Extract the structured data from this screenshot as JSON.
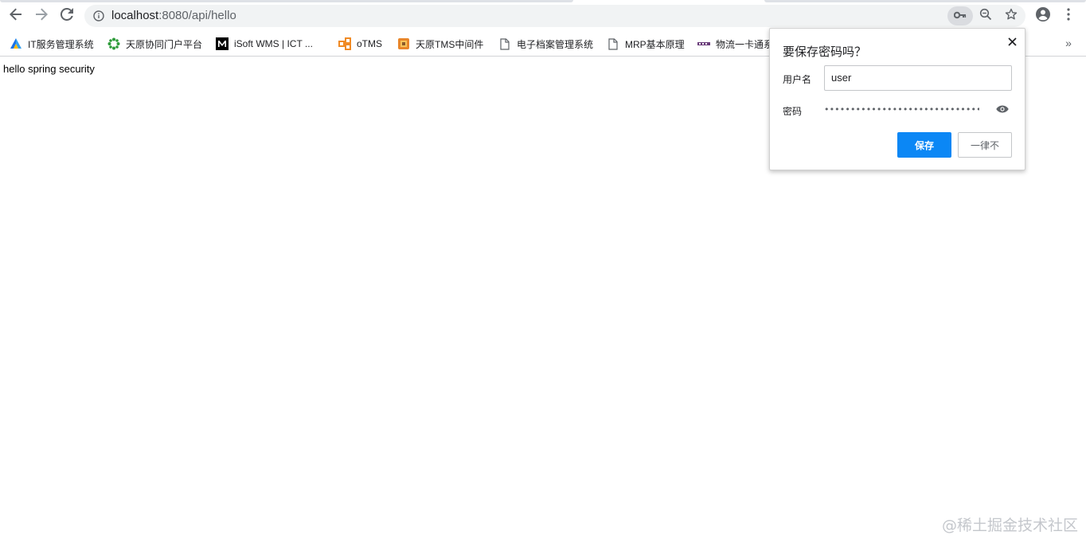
{
  "browser": {
    "url_host": "localhost",
    "url_path": ":8080/api/hello",
    "icons": {
      "back": "arrow-back-icon",
      "forward": "arrow-forward-icon",
      "reload": "reload-icon",
      "info": "info-icon",
      "key": "key-icon",
      "zoom": "zoom-icon",
      "star": "star-icon",
      "account": "account-icon",
      "menu": "kebab-menu-icon"
    }
  },
  "bookmarks": [
    {
      "label": "IT服务管理系统",
      "icon": "triangle-logo-icon"
    },
    {
      "label": "天原协同门户平台",
      "icon": "gear-flower-icon"
    },
    {
      "label": "iSoft WMS | ICT ...",
      "icon": "m-logo-icon"
    },
    {
      "label": "oTMS",
      "icon": "otms-logo-icon"
    },
    {
      "label": "天原TMS中间件",
      "icon": "tms-logo-icon"
    },
    {
      "label": "电子档案管理系统",
      "icon": "page-icon"
    },
    {
      "label": "MRP基本原理",
      "icon": "page-icon"
    },
    {
      "label": "物流一卡通系",
      "icon": "small-logo-icon"
    }
  ],
  "bookmarks_more": "»",
  "page": {
    "body_text": "hello spring security"
  },
  "save_password_bubble": {
    "title": "要保存密码吗？",
    "username_label": "用户名",
    "username_value": "user",
    "password_label": "密码",
    "password_value": "••••••••••••••••••••••••••••••••...",
    "save_label": "保存",
    "never_label": "一律不",
    "close_icon": "close-icon",
    "eye_icon": "eye-icon"
  },
  "watermark": "@稀土掘金技术社区",
  "colors": {
    "primary_button": "#0b87f5",
    "omnibox_bg": "#f1f3f4"
  }
}
